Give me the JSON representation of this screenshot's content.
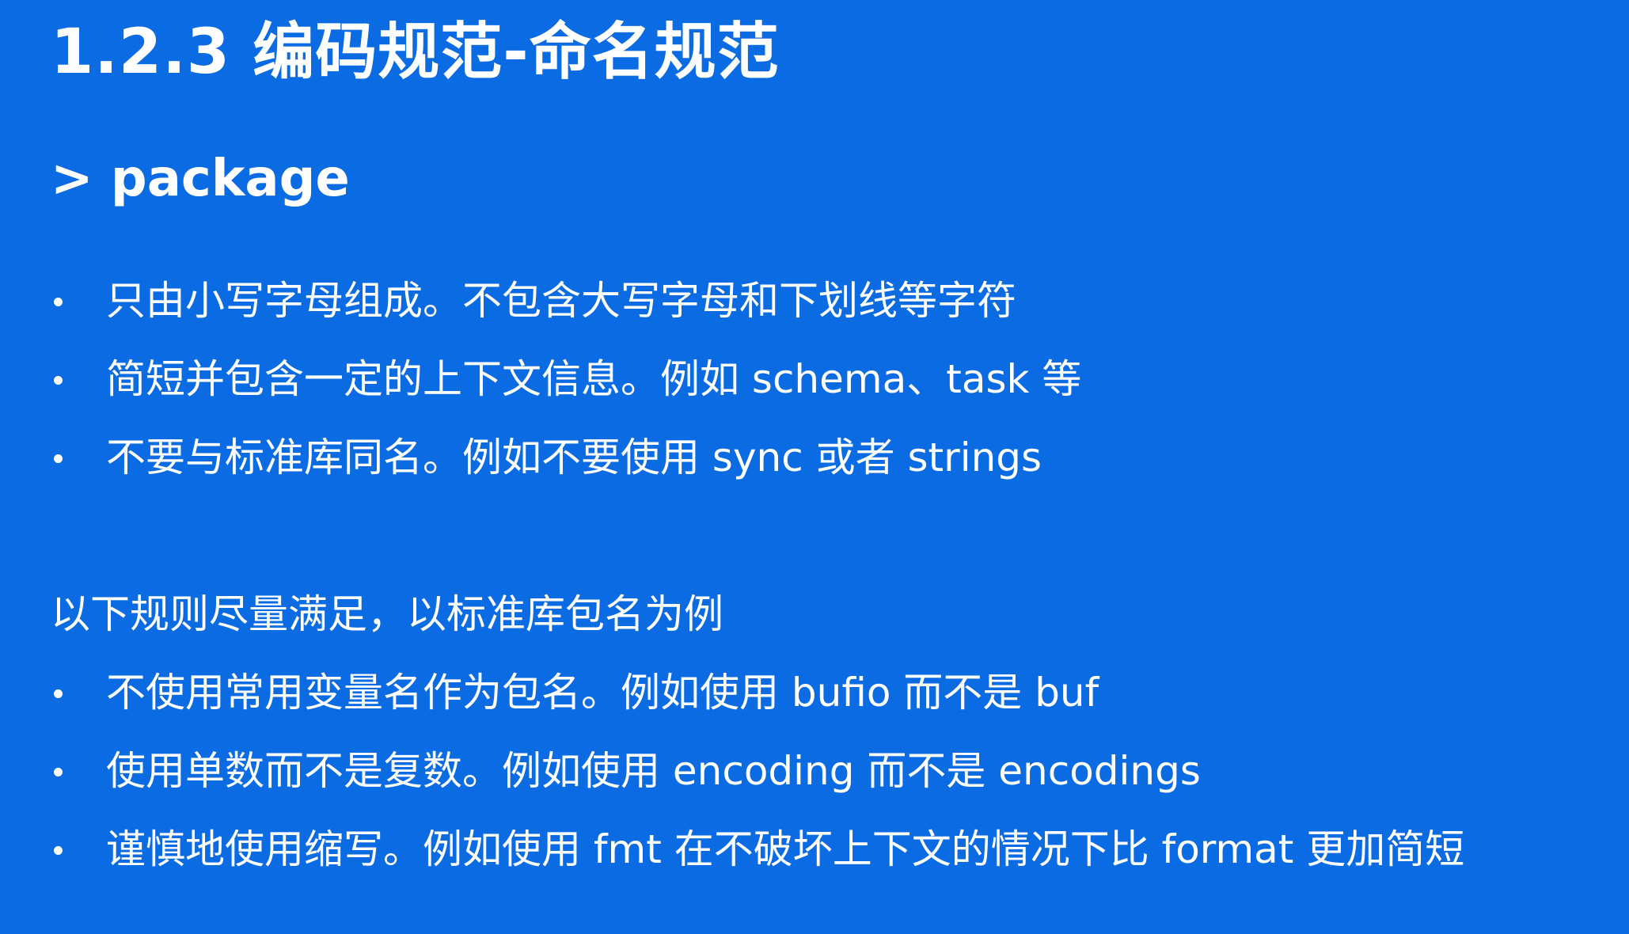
{
  "title": "1.2.3 编码规范-命名规范",
  "section": {
    "heading": "> package"
  },
  "rules": [
    {
      "text": "只由小写字母组成。不包含大写字母和下划线等字符"
    },
    {
      "text": "简短并包含一定的上下文信息。例如 schema、task 等"
    },
    {
      "text": "不要与标准库同名。例如不要使用 sync 或者 strings"
    }
  ],
  "guidelines": {
    "intro": "以下规则尽量满足，以标准库包名为例",
    "items": [
      {
        "text": "不使用常用变量名作为包名。例如使用 bufio 而不是 buf"
      },
      {
        "text": "使用单数而不是复数。例如使用 encoding 而不是 encodings"
      },
      {
        "text": "谨慎地使用缩写。例如使用 fmt 在不破坏上下文的情况下比 format 更加简短"
      }
    ]
  },
  "colors": {
    "background": "#0A6BE3",
    "text": "#FFFFFF"
  }
}
